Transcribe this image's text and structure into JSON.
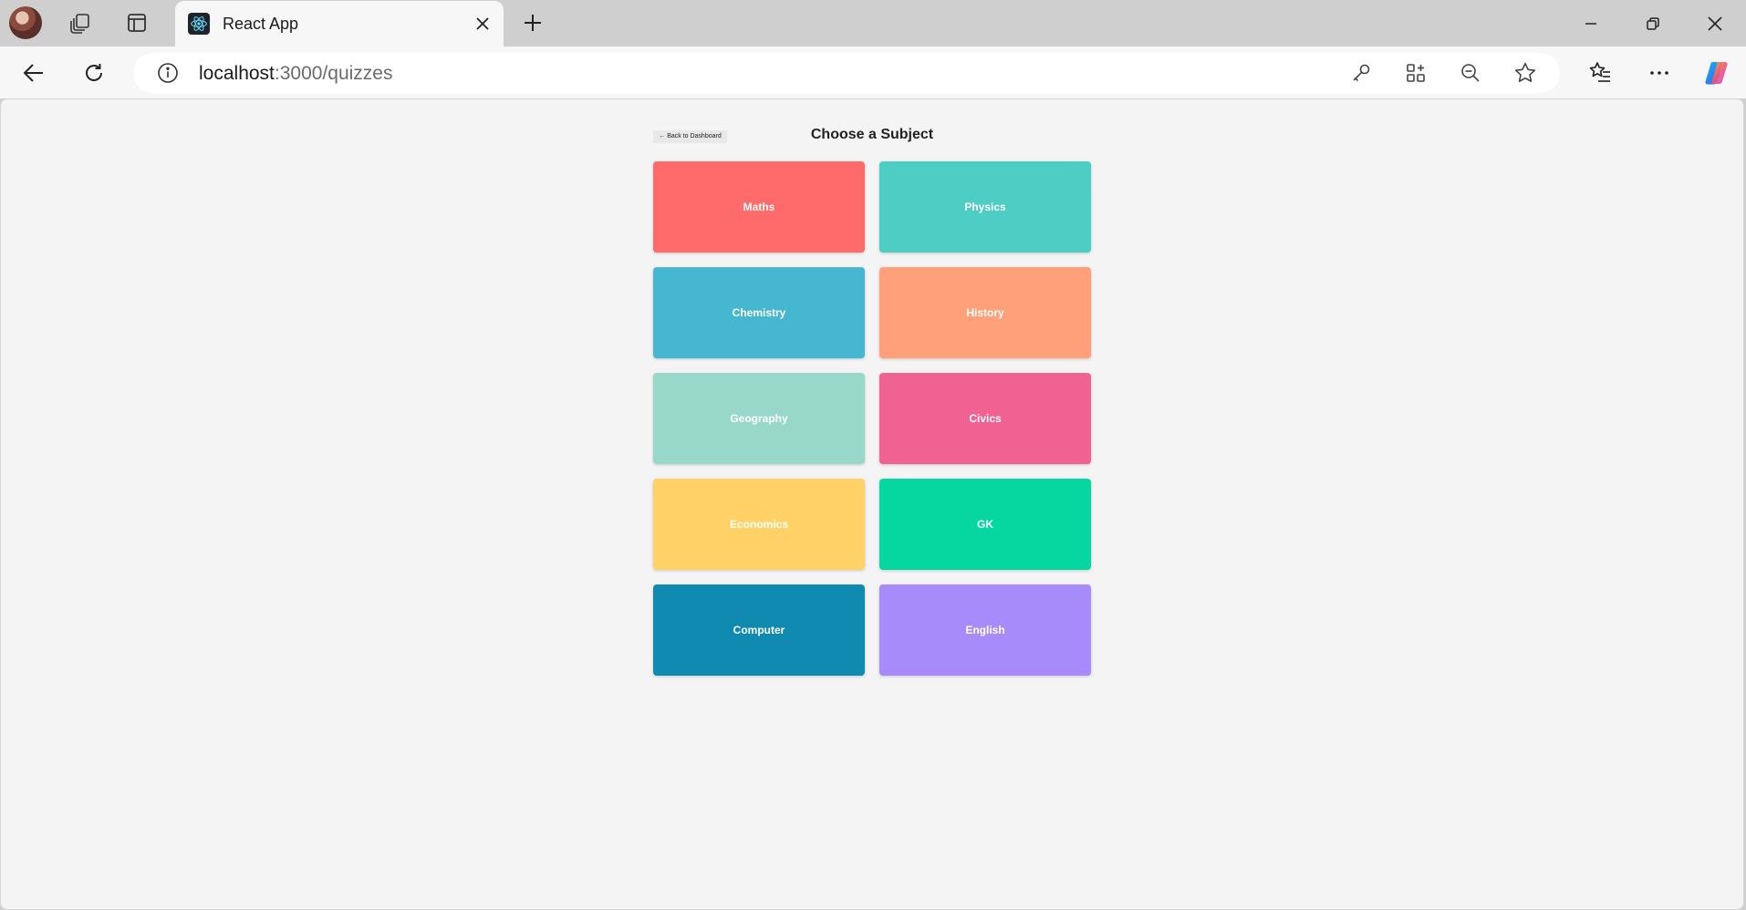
{
  "browser": {
    "tab": {
      "title": "React App",
      "favicon": "react-logo-icon"
    },
    "address_bar": {
      "host": "localhost",
      "path": ":3000/quizzes"
    }
  },
  "page": {
    "back_button_label": "← Back to Dashboard",
    "title": "Choose a Subject",
    "subjects": [
      {
        "label": "Maths",
        "color": "#ff6b6b"
      },
      {
        "label": "Physics",
        "color": "#4ecdc4"
      },
      {
        "label": "Chemistry",
        "color": "#45b7d1"
      },
      {
        "label": "History",
        "color": "#ffa07a"
      },
      {
        "label": "Geography",
        "color": "#98d8c8"
      },
      {
        "label": "Civics",
        "color": "#f06292"
      },
      {
        "label": "Economics",
        "color": "#ffd166"
      },
      {
        "label": "GK",
        "color": "#06d6a0"
      },
      {
        "label": "Computer",
        "color": "#118ab2"
      },
      {
        "label": "English",
        "color": "#a78bfa"
      }
    ]
  }
}
